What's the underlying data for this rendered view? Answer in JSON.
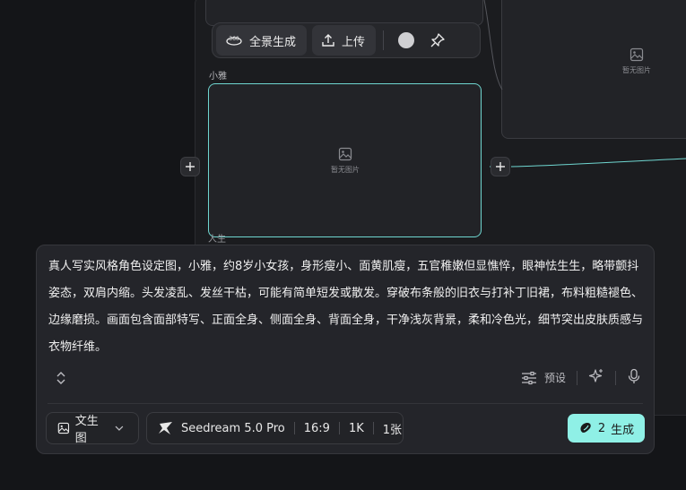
{
  "canvas": {
    "top_placeholder": "暂无图片",
    "node": {
      "label": "小雅",
      "placeholder": "暂无图片",
      "sub_label": "人生"
    }
  },
  "toolbar": {
    "panorama_label": "全景生成",
    "upload_label": "上传"
  },
  "prompt": {
    "text": "真人写实风格角色设定图，小雅，约8岁小女孩，身形瘦小、面黄肌瘦，五官稚嫩但显憔悴，眼神怯生生，略带颤抖姿态，双肩内缩。头发凌乱、发丝干枯，可能有简单短发或散发。穿破布条般的旧衣与打补丁旧裙，布料粗糙褪色、边缘磨损。画面包含面部特写、正面全身、侧面全身、背面全身，干净浅灰背景，柔和冷色光，细节突出皮肤质感与衣物纤维。",
    "preset_label": "预设"
  },
  "bottom_bar": {
    "mode_label": "文生图",
    "model_name": "Seedream 5.0 Pro",
    "aspect_ratio": "16:9",
    "resolution": "1K",
    "count": "1张",
    "generate_cost": "2",
    "generate_label": "生成"
  },
  "colors": {
    "accent": "#8ff0e6",
    "node_border": "#6fd6d0",
    "background": "#141518"
  }
}
